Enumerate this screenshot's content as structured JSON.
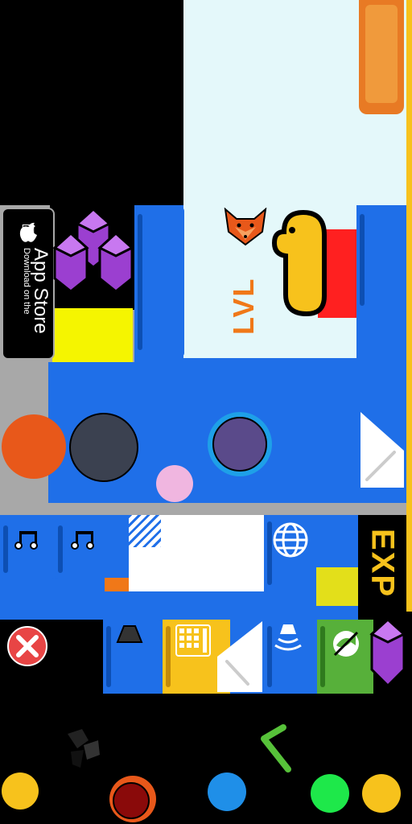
{
  "app_store": {
    "line1": "Download on the",
    "line2": "App Store"
  },
  "badges": {
    "exp_label": "EXP",
    "lvl_label": "LVL"
  },
  "icons": {
    "apple": "apple-icon",
    "music": "music-note-icon",
    "globe": "globe-icon",
    "close": "close-icon",
    "fox": "fox-face-icon",
    "crystal": "purple-crystal-icon",
    "keypad": "keypad-icon",
    "no_fishing": "no-fishing-icon",
    "horn": "horn-icon",
    "sound": "sound-icon"
  },
  "colors": {
    "primary_blue": "#1f6fe8",
    "dark_blue": "#0d4fb3",
    "orange": "#e8581a",
    "yellow": "#f7c21c",
    "purple": "#9b3fd0",
    "green": "#57b03a",
    "red_close": "#e84545",
    "slate": "#3b4150"
  }
}
